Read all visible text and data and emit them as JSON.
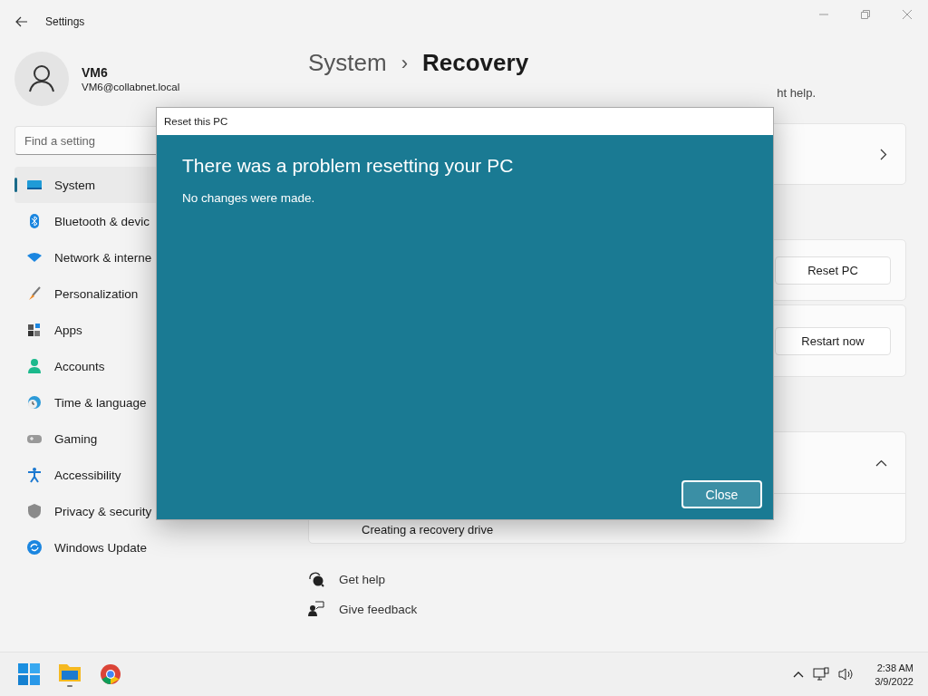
{
  "window": {
    "title": "Settings"
  },
  "user": {
    "name": "VM6",
    "email": "VM6@collabnet.local"
  },
  "search": {
    "placeholder": "Find a setting"
  },
  "sidebar": {
    "items": [
      {
        "label": "System",
        "selected": true
      },
      {
        "label": "Bluetooth & devic",
        "selected": false
      },
      {
        "label": "Network & interne",
        "selected": false
      },
      {
        "label": "Personalization",
        "selected": false
      },
      {
        "label": "Apps",
        "selected": false
      },
      {
        "label": "Accounts",
        "selected": false
      },
      {
        "label": "Time & language",
        "selected": false
      },
      {
        "label": "Gaming",
        "selected": false
      },
      {
        "label": "Accessibility",
        "selected": false
      },
      {
        "label": "Privacy & security",
        "selected": false
      },
      {
        "label": "Windows Update",
        "selected": false
      }
    ]
  },
  "breadcrumb": {
    "parent": "System",
    "separator": "›",
    "current": "Recovery"
  },
  "description_fragment": "ht help.",
  "cards": [
    {
      "kind": "chevron"
    },
    {
      "kind": "button",
      "button": "Reset PC"
    },
    {
      "kind": "button",
      "button": "Restart now"
    },
    {
      "kind": "expanded",
      "row": "Creating a recovery drive"
    }
  ],
  "links": [
    {
      "label": "Get help"
    },
    {
      "label": "Give feedback"
    }
  ],
  "dialog": {
    "title": "Reset this PC",
    "heading": "There was a problem resetting your PC",
    "message": "No changes were made.",
    "button": "Close"
  },
  "taskbar": {
    "time": "2:38 AM",
    "date": "3/9/2022"
  }
}
